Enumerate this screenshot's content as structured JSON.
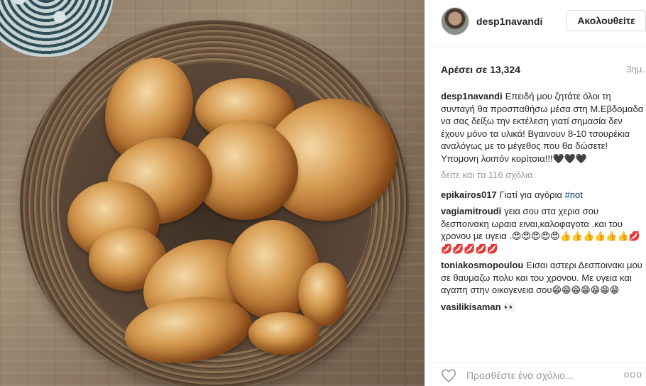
{
  "post": {
    "username": "desp1navandi",
    "follow_label": "Ακολουθείτε",
    "likes_text": "Αρέσει σε 13,324",
    "time_ago": "3ημ."
  },
  "caption": {
    "user": "desp1navandi",
    "text": "Επειδή μου ζητάτε όλοι τη συνταγή θα προσπαθήσω μέσα στη Μ.Εβδομαδα να σας δείξω την εκτέλεση γιατί σημασία δεν έχουν μόνο τα υλικά! Βγαινουν 8-10 τσουρέκια αναλόγως με το μέγεθος που θα δώσετε!Υπομονη λοιπόν κορίτσια!!!🖤🖤🖤"
  },
  "view_all_comments": "δείτε και τα 116 σχόλια",
  "comments": [
    {
      "user": "epikairos017",
      "text": "Γιατί για αγόρια ",
      "hashtag": "#not"
    },
    {
      "user": "vagiamitroudi",
      "text": "γεια σου στα χερια σου δεσποινακη ωραια ειναι,καλοφαγοτα .και του χρονου με υγεια .😍😍😍😍😍👍👍👍👍👍👍💋💋💋💋💋💋"
    },
    {
      "user": "toniakosmopoulou",
      "text": "Εισαι αστερι Δεσποινακι μου σε θαυμαζω πολυ και του χρονου. Με υγεια και αγαπη στην οικογενεια σου😁😁😁😁😁😁😁"
    },
    {
      "user": "vasilikisaman",
      "text": "👀"
    }
  ],
  "footer": {
    "add_comment_placeholder": "Προσθέστε ένα σχόλιο...",
    "more_label": "ooo"
  },
  "icons": {
    "like": "heart-icon",
    "more": "more-options-icon"
  }
}
